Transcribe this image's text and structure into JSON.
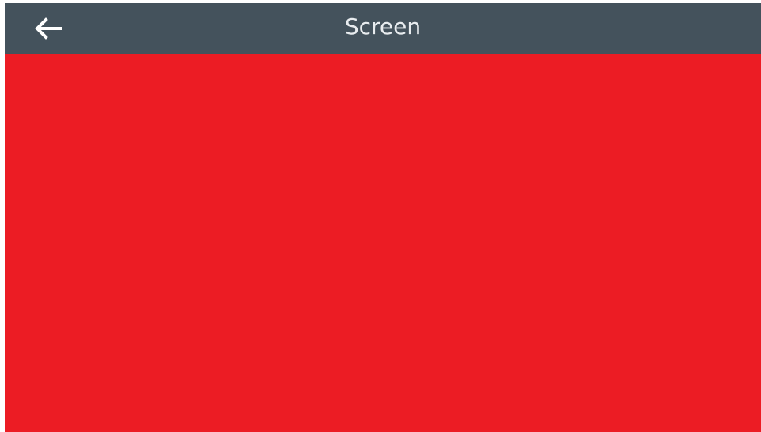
{
  "header": {
    "title": "Screen",
    "back_icon": "back-arrow-icon"
  },
  "content": {
    "background_color": "#ec1c24"
  },
  "colors": {
    "header_background": "#44525c",
    "header_text": "#e8ecef",
    "content_background": "#ec1c24"
  }
}
